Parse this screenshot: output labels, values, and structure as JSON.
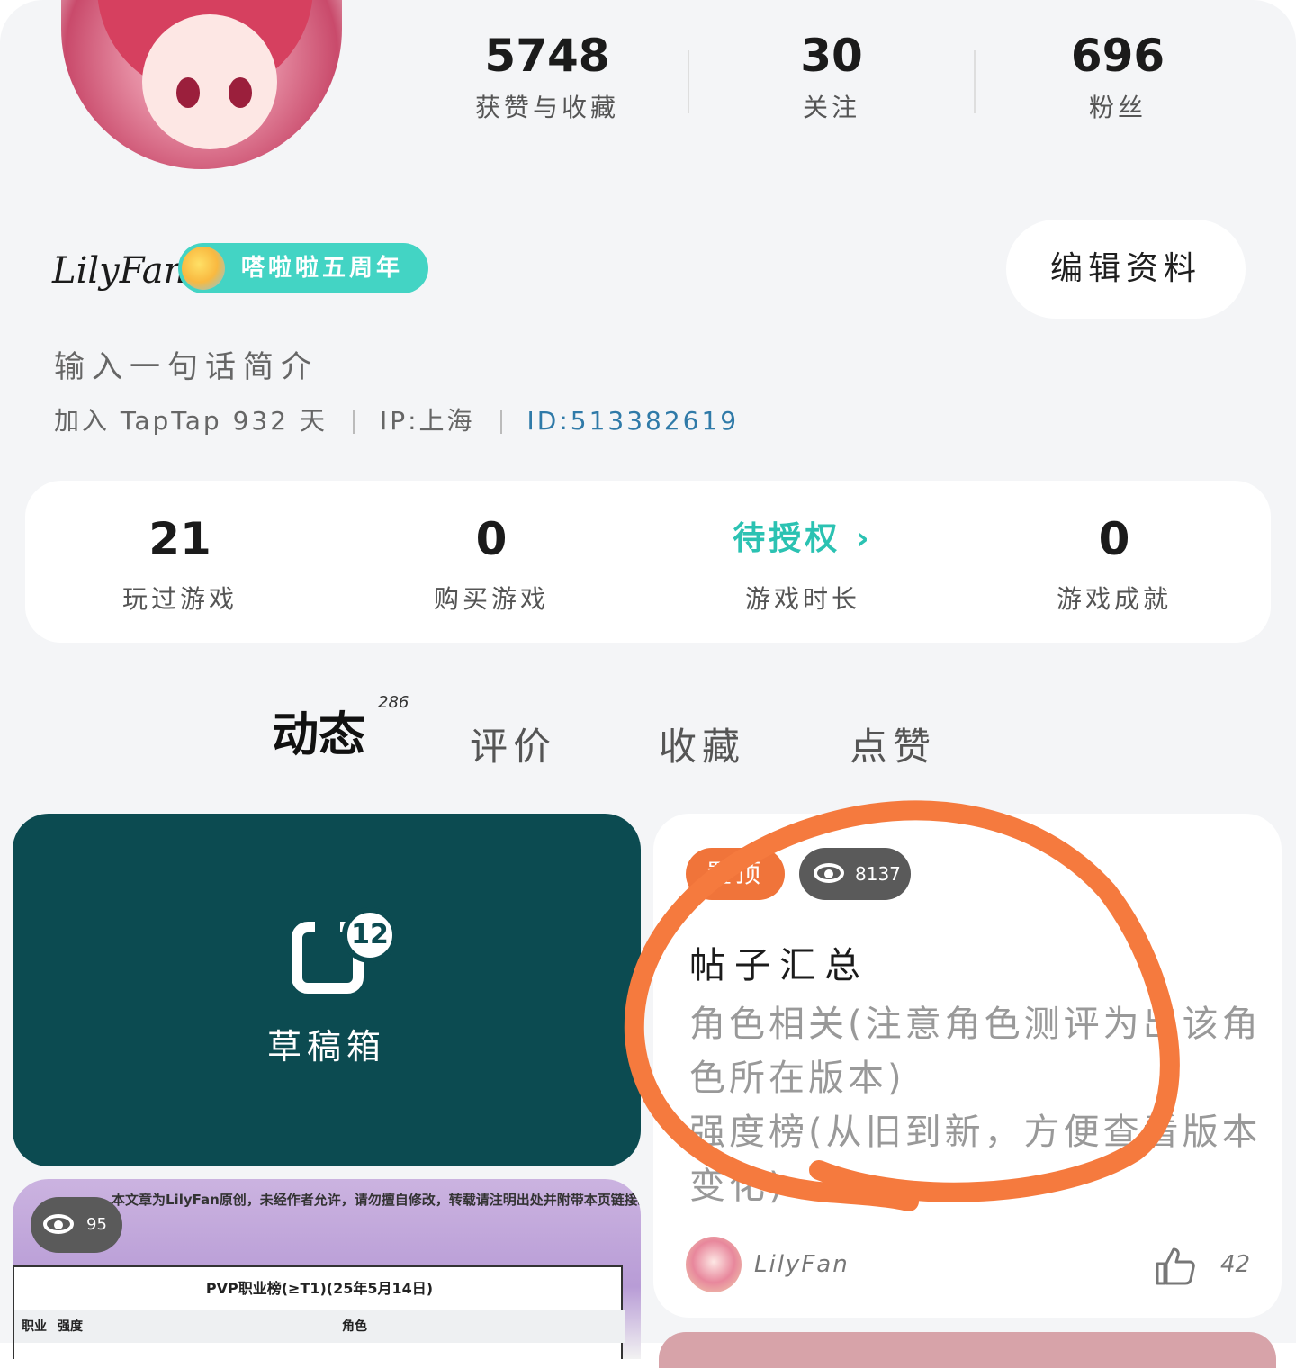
{
  "profile": {
    "stats": [
      {
        "value": "5748",
        "label": "获赞与收藏"
      },
      {
        "value": "30",
        "label": "关注"
      },
      {
        "value": "696",
        "label": "粉丝"
      }
    ],
    "username": "LilyFan",
    "badge_text": "嗒啦啦五周年",
    "edit_label": "编辑资料",
    "bio": "输入一句话简介",
    "joined": "加入 TapTap 932 天",
    "ip": "IP:上海",
    "id": "ID:513382619"
  },
  "game_stats": [
    {
      "value": "21",
      "label": "玩过游戏"
    },
    {
      "value": "0",
      "label": "购买游戏"
    },
    {
      "value": "待授权",
      "label": "游戏时长"
    },
    {
      "value": "0",
      "label": "游戏成就"
    }
  ],
  "tabs": [
    {
      "label": "动态",
      "count": "286"
    },
    {
      "label": "评价"
    },
    {
      "label": "收藏"
    },
    {
      "label": "点赞"
    }
  ],
  "draft": {
    "label": "草稿箱",
    "count": "12"
  },
  "post": {
    "pin_label": "置顶",
    "views": "8137",
    "title": "帖子汇总",
    "body": "角色相关(注意角色测评为出该角色所在版本)\n强度榜(从旧到新，方便查看版本变化)",
    "author": "LilyFan",
    "likes": "42"
  },
  "image_post": {
    "views": "95",
    "notice": "本文章为LilyFan原创，未经作者允许，请勿擅自修改，转载请注明出处并附带本页链接。",
    "table_title": "PVP职业榜(≥T1)(25年5月14日)",
    "col_job": "职业",
    "col_strength": "强度",
    "col_role": "角色"
  },
  "colors": {
    "accent_teal": "#2bc2b2",
    "draft_bg": "#0c4b51",
    "pin_orange": "#f0743a",
    "annotation_orange": "#f57a3e"
  }
}
